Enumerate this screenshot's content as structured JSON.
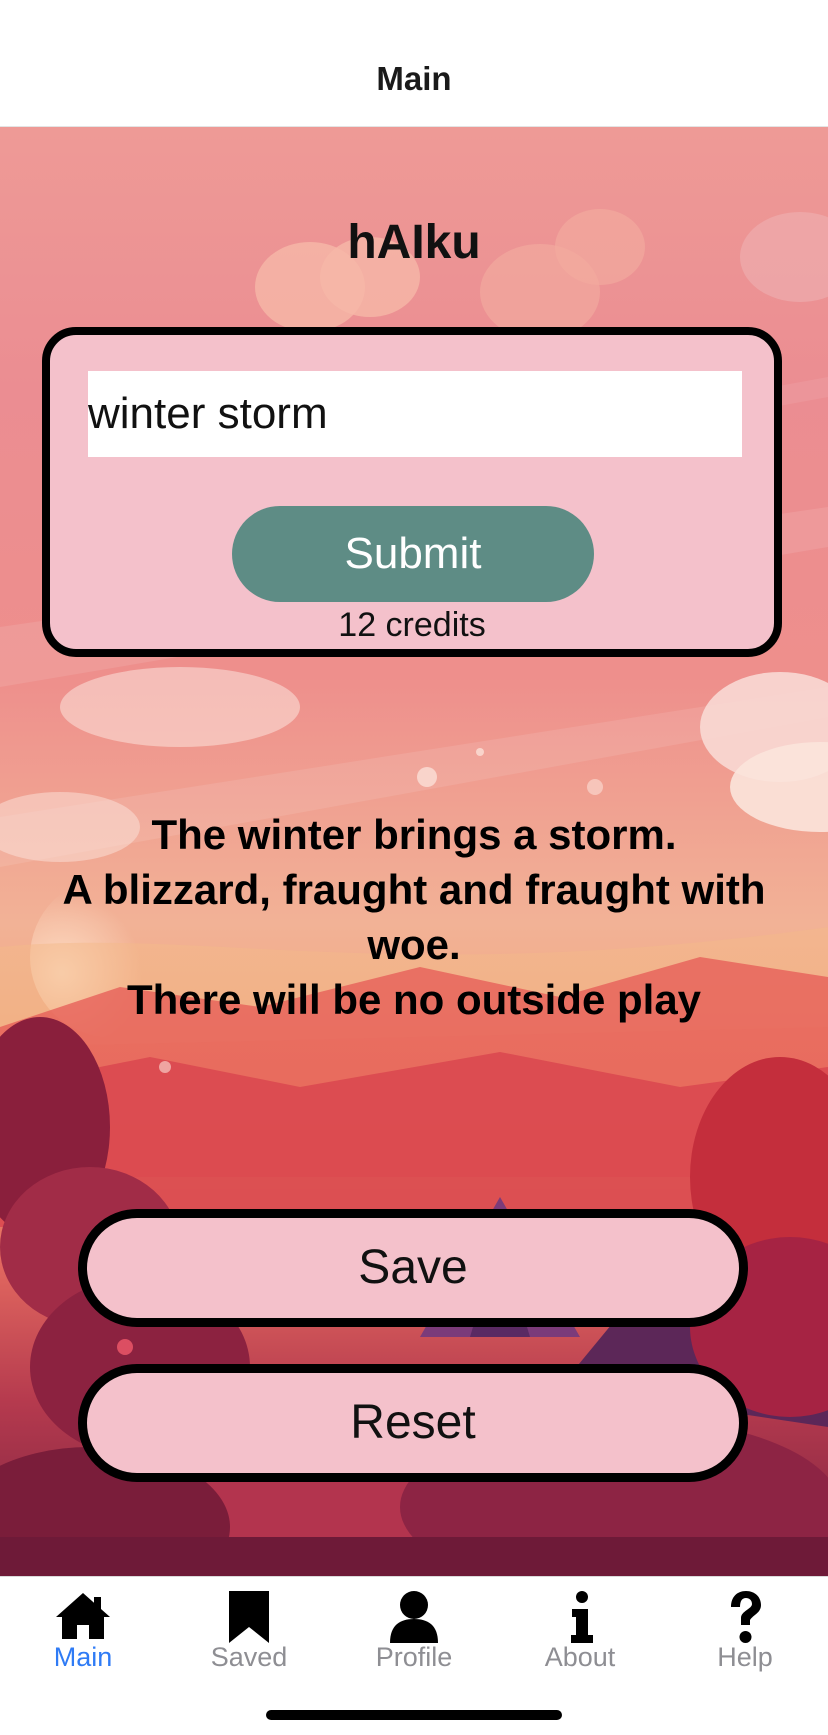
{
  "nav": {
    "title": "Main"
  },
  "app": {
    "title": "hAIku"
  },
  "form": {
    "input_value": "winter storm",
    "submit_label": "Submit",
    "credits_text": "12 credits"
  },
  "haiku": {
    "lines": [
      "The winter brings a storm.",
      "A blizzard, fraught and fraught with woe.",
      "There will be no outside play"
    ]
  },
  "actions": {
    "save_label": "Save",
    "reset_label": "Reset"
  },
  "tabs": [
    {
      "label": "Main",
      "icon": "home-icon",
      "active": true
    },
    {
      "label": "Saved",
      "icon": "bookmark-icon",
      "active": false
    },
    {
      "label": "Profile",
      "icon": "person-icon",
      "active": false
    },
    {
      "label": "About",
      "icon": "info-icon",
      "active": false
    },
    {
      "label": "Help",
      "icon": "question-icon",
      "active": false
    }
  ],
  "colors": {
    "submit_button": "#5e8c85",
    "card_background": "#f4c1cb",
    "active_tab": "#2f7bf5",
    "inactive_tab": "#8e8e93"
  }
}
